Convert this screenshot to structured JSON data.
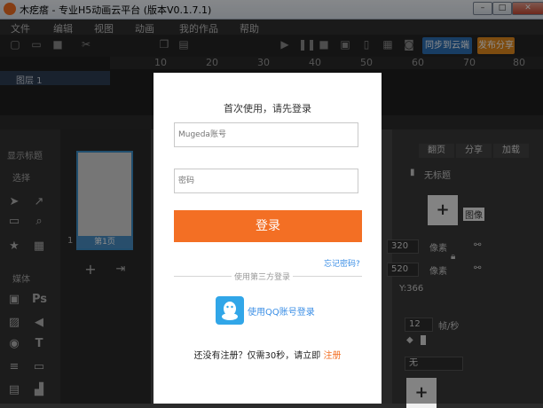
{
  "window": {
    "title": "木疙瘩 - 专业H5动画云平台 (版本V0.1.7.1)",
    "min": "–",
    "max": "□",
    "close": "✕"
  },
  "menu": [
    "文件",
    "编辑",
    "视图",
    "动画",
    "我的作品",
    "帮助"
  ],
  "toolbar": {
    "publish_label": "同步到云端",
    "share_label": "发布分享"
  },
  "timeline": {
    "ticks": [
      "10",
      "20",
      "30",
      "40",
      "50",
      "60",
      "70",
      "80"
    ],
    "layer": "图层 1"
  },
  "left_panel": {
    "show_label": "显示标题",
    "select_section": "选择",
    "media_section": "媒体",
    "ps_label": "Ps",
    "text_tool": "T"
  },
  "pages_panel": {
    "page_num": "1",
    "page_label": "第1页"
  },
  "right_panel": {
    "tabs": [
      "翻页",
      "分享",
      "加载"
    ],
    "untitled": "无标题",
    "image_badge": "图像",
    "width_value": "320",
    "height_value": "520",
    "px_unit": "像素",
    "y_readout": "Y:366",
    "fps_value": "12",
    "fps_unit": "帧/秒",
    "none_option": "无"
  },
  "modal": {
    "title": "首次使用，请先登录",
    "account_placeholder": "Mugeda账号",
    "password_placeholder": "密码",
    "login_label": "登录",
    "forgot_label": "忘记密码?",
    "third_party_label": "使用第三方登录",
    "qq_label": "使用QQ账号登录",
    "register_prompt": "还没有注册？仅需30秒，请立即 ",
    "register_link": "注册"
  },
  "colors": {
    "accent": "#f36f24",
    "link": "#3a8ee6",
    "qq": "#31a6e8"
  }
}
